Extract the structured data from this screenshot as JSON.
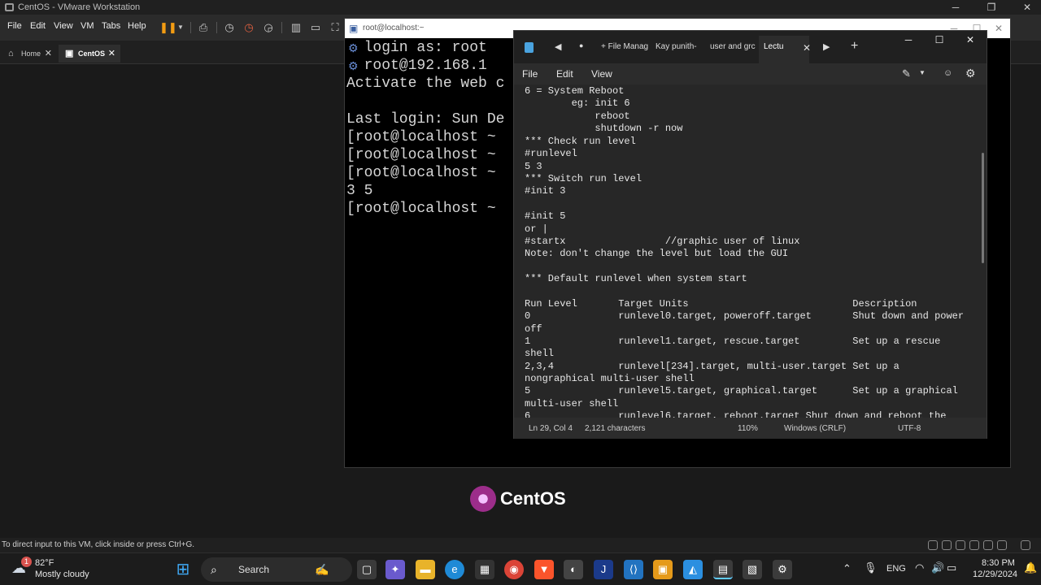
{
  "vmware": {
    "title": "CentOS - VMware Workstation",
    "menu": [
      "File",
      "Edit",
      "View",
      "VM",
      "Tabs",
      "Help"
    ],
    "tabs": [
      {
        "label": "Home"
      },
      {
        "label": "CentOS"
      }
    ],
    "hint": "To direct input to this VM, click inside or press Ctrl+G."
  },
  "console": {
    "title": "root@localhost:~",
    "lines": [
      "  login as: root",
      "  root@192.168.1",
      "Activate the web c",
      "",
      "Last login: Sun De",
      "[root@localhost ~",
      "[root@localhost ~",
      "[root@localhost ~",
      "3 5",
      "[root@localhost ~"
    ]
  },
  "notepad": {
    "tabs": [
      "+ File Manag",
      "Kay punith-",
      "user and grc",
      "Lectu"
    ],
    "menu": [
      "File",
      "Edit",
      "View"
    ],
    "lines": [
      "6 = System Reboot",
      "        eg: init 6",
      "            reboot",
      "            shutdown -r now",
      "*** Check run level",
      "#runlevel",
      "5 3",
      "*** Switch run level",
      "#init 3",
      "",
      "#init 5",
      "or |",
      "#startx                 //graphic user of linux",
      "Note: don't change the level but load the GUI",
      "",
      "*** Default runlevel when system start",
      "",
      "Run Level       Target Units                            Description",
      "0               runlevel0.target, poweroff.target       Shut down and power",
      "off",
      "1               runlevel1.target, rescue.target         Set up a rescue",
      "shell",
      "2,3,4           runlevel[234].target, multi-user.target Set up a",
      "nongraphical multi-user shell",
      "5               runlevel5.target, graphical.target      Set up a graphical",
      "multi-user shell",
      "6               runlevel6.target, reboot.target Shut down and reboot the"
    ],
    "status": {
      "position": "Ln 29, Col 4",
      "characters": "2,121 characters",
      "zoom": "110%",
      "line_ending": "Windows (CRLF)",
      "encoding": "UTF-8"
    }
  },
  "brand": "CentOS",
  "taskbar": {
    "weather_temp": "82°F",
    "weather_desc": "Mostly cloudy",
    "weather_badge": "1",
    "search_label": "Search",
    "language": "ENG",
    "time": "8:30 PM",
    "date": "12/29/2024"
  }
}
